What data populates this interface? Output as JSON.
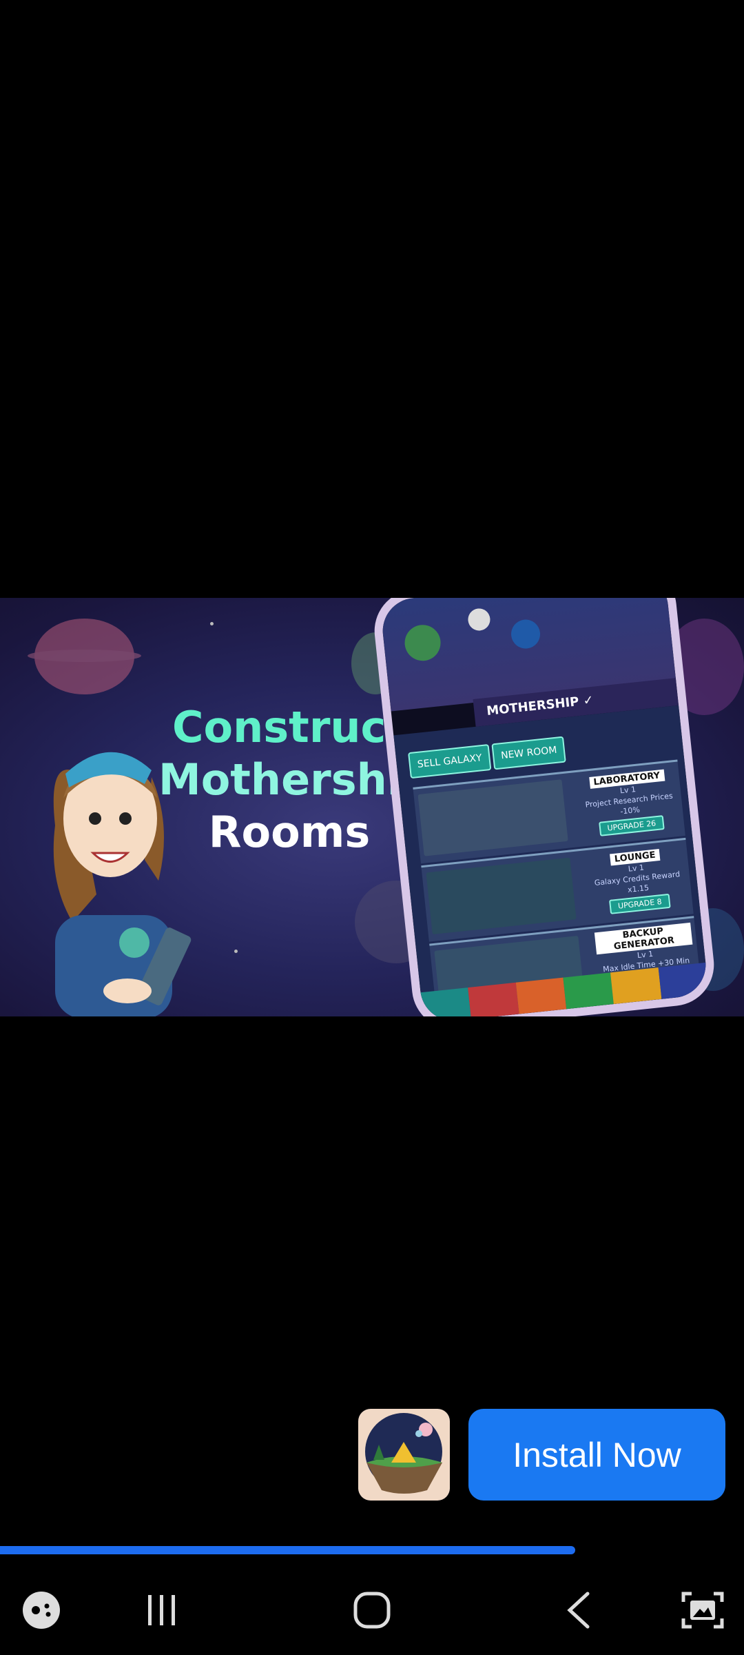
{
  "ad": {
    "headline": [
      "Construct",
      "Mothership",
      "Rooms"
    ],
    "game_screen": {
      "header": "MOTHERSHIP",
      "buttons": [
        "SELL GALAXY",
        "NEW ROOM"
      ],
      "rooms": [
        {
          "name": "LABORATORY",
          "level": "Lv 1",
          "effect": "Project Research Prices",
          "value": "-10%",
          "upgrade": "UPGRADE",
          "cost": "26"
        },
        {
          "name": "LOUNGE",
          "level": "Lv 1",
          "effect": "Galaxy Credits Reward",
          "value": "x1.15",
          "upgrade": "UPGRADE",
          "cost": "8"
        },
        {
          "name": "BACKUP GENERATOR",
          "level": "Lv 1",
          "effect": "Max Idle Time +30 Min"
        }
      ]
    }
  },
  "install": {
    "button_label": "Install Now",
    "accent_color": "#1a79f2"
  },
  "video_progress": 0.773,
  "navbar": {
    "icons": [
      "game-controller-icon",
      "recent-apps-icon",
      "home-icon",
      "back-icon",
      "screenshot-icon"
    ]
  }
}
